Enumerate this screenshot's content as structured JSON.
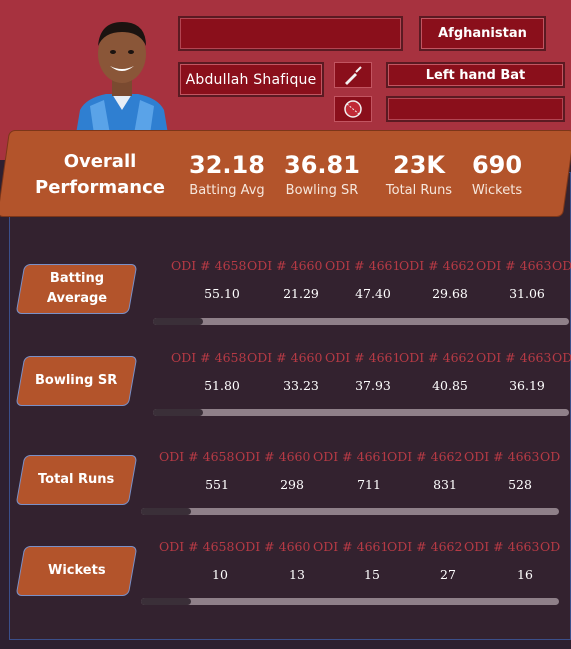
{
  "player": {
    "name": "Abdullah Shafique",
    "country": "Afghanistan",
    "batting_style": "Left hand Bat",
    "blank_field_top": "",
    "blank_field_bottom": ""
  },
  "icons": {
    "bat": "cricket-bat-icon",
    "ball": "cricket-ball-icon"
  },
  "kpi": {
    "title": "Overall Performance",
    "items": [
      {
        "value": "32.18",
        "label": "Batting Avg"
      },
      {
        "value": "36.81",
        "label": "Bowling SR"
      },
      {
        "value": "23K",
        "label": "Total Runs"
      },
      {
        "value": "690",
        "label": "Wickets"
      }
    ]
  },
  "sections": [
    {
      "label": "Batting Average",
      "matches": [
        "ODI # 4658",
        "ODI # 4660",
        "ODI # 4661",
        "ODI # 4662",
        "ODI # 4663",
        "OD"
      ],
      "values": [
        "55.10",
        "21.29",
        "47.40",
        "29.68",
        "31.06"
      ]
    },
    {
      "label": "Bowling SR",
      "matches": [
        "ODI # 4658",
        "ODI # 4660",
        "ODI # 4661",
        "ODI # 4662",
        "ODI # 4663",
        "OD"
      ],
      "values": [
        "51.80",
        "33.23",
        "37.93",
        "40.85",
        "36.19"
      ]
    },
    {
      "label": "Total Runs",
      "matches": [
        "ODI # 4658",
        "ODI # 4660",
        "ODI # 4661",
        "ODI # 4662",
        "ODI # 4663",
        "OD"
      ],
      "values": [
        "551",
        "298",
        "711",
        "831",
        "528"
      ]
    },
    {
      "label": "Wickets",
      "matches": [
        "ODI # 4658",
        "ODI # 4660",
        "ODI # 4661",
        "ODI # 4662",
        "ODI # 4663",
        "OD"
      ],
      "values": [
        "10",
        "13",
        "15",
        "27",
        "16"
      ]
    }
  ],
  "colors": {
    "header_bg": "#a7323f",
    "page_bg": "#2e2030",
    "accent_orange": "#b3542b",
    "field_red": "#8a0f1b",
    "match_label": "#b63a45"
  }
}
